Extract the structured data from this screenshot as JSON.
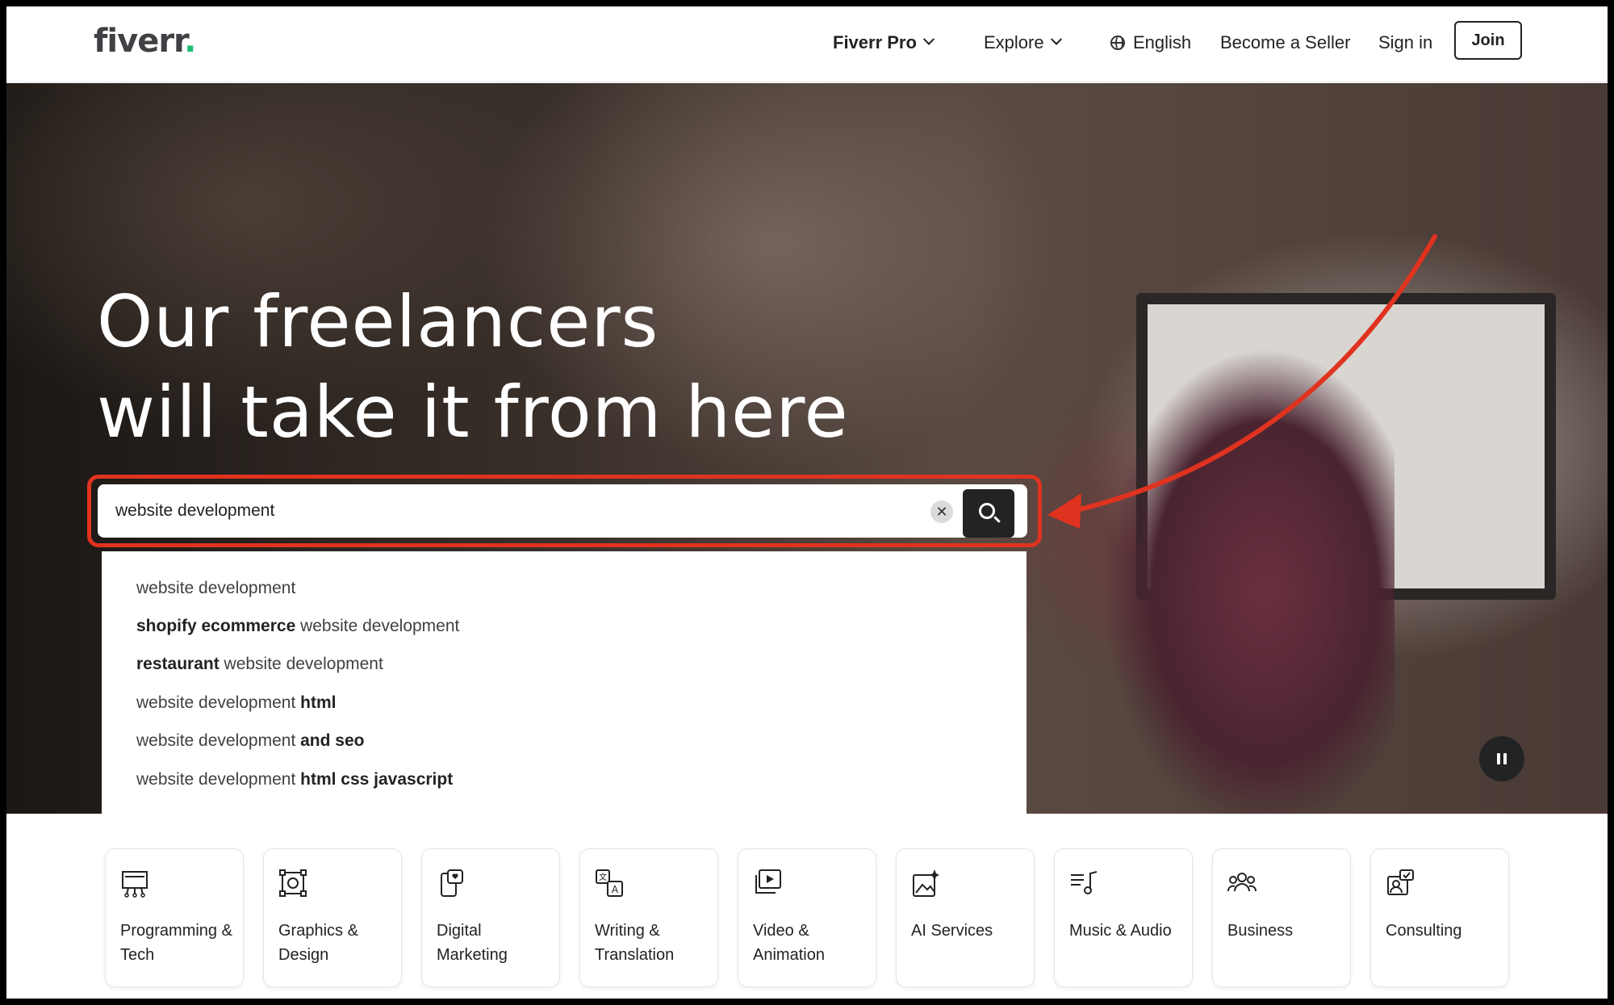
{
  "header": {
    "logo_text": "fiverr",
    "logo_dot": ".",
    "nav": {
      "fiverr_pro": "Fiverr Pro",
      "explore": "Explore",
      "language": "English",
      "become_seller": "Become a Seller",
      "sign_in": "Sign in",
      "join": "Join"
    }
  },
  "hero": {
    "title_line1": "Our freelancers",
    "title_line2": "will take it from here",
    "search": {
      "value": "website development",
      "clear_symbol": "✕"
    },
    "suggestions": [
      {
        "plain_before": "website development",
        "bold": "",
        "plain_after": ""
      },
      {
        "plain_before": "",
        "bold": "shopify ecommerce",
        "plain_after": " website development"
      },
      {
        "plain_before": "",
        "bold": "restaurant",
        "plain_after": " website development"
      },
      {
        "plain_before": "website development ",
        "bold": "html",
        "plain_after": ""
      },
      {
        "plain_before": "website development ",
        "bold": "and seo",
        "plain_after": ""
      },
      {
        "plain_before": "website development ",
        "bold": "html css javascript",
        "plain_after": ""
      }
    ]
  },
  "categories": [
    {
      "label": "Programming & Tech",
      "icon": "programming-icon"
    },
    {
      "label": "Graphics & Design",
      "icon": "graphics-icon"
    },
    {
      "label": "Digital Marketing",
      "icon": "digital-marketing-icon"
    },
    {
      "label": "Writing & Translation",
      "icon": "translation-icon"
    },
    {
      "label": "Video & Animation",
      "icon": "video-icon"
    },
    {
      "label": "AI Services",
      "icon": "ai-icon"
    },
    {
      "label": "Music & Audio",
      "icon": "music-icon"
    },
    {
      "label": "Business",
      "icon": "business-icon"
    },
    {
      "label": "Consulting",
      "icon": "consulting-icon"
    }
  ],
  "colors": {
    "brand_green": "#1dbf73",
    "highlight_red": "#e0331f",
    "dark": "#222325"
  }
}
